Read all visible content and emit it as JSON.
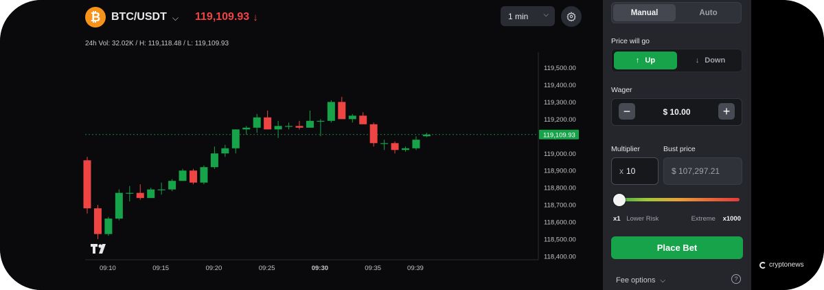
{
  "header": {
    "pair": "BTC/USDT",
    "price": "119,109.93",
    "coin_icon": "bitcoin-icon",
    "stats": "24h Vol: 32.02K / H: 119,118.48 / L: 119,109.93",
    "interval": "1 min"
  },
  "colors": {
    "up": "#16a34a",
    "down": "#ef4444",
    "accent": "#16a34a"
  },
  "chart_data": {
    "type": "candlestick",
    "y_ticks": [
      "119,500.00",
      "119,400.00",
      "119,300.00",
      "119,200.00",
      "119,100.00",
      "119,000.00",
      "118,900.00",
      "118,800.00",
      "118,700.00",
      "118,600.00",
      "118,500.00",
      "118,400.00"
    ],
    "ylim": [
      118380,
      119590
    ],
    "current_price_label": "119,109.93",
    "current_price": 119110,
    "x_ticks": [
      {
        "label": "09:10",
        "bold": false,
        "index": 2
      },
      {
        "label": "09:15",
        "bold": false,
        "index": 7
      },
      {
        "label": "09:20",
        "bold": false,
        "index": 12
      },
      {
        "label": "09:25",
        "bold": false,
        "index": 17
      },
      {
        "label": "09:30",
        "bold": true,
        "index": 22
      },
      {
        "label": "09:35",
        "bold": false,
        "index": 27
      },
      {
        "label": "09:39",
        "bold": false,
        "index": 31
      }
    ],
    "candles": [
      {
        "o": 118960,
        "h": 118980,
        "l": 118650,
        "c": 118680
      },
      {
        "o": 118680,
        "h": 118700,
        "l": 118500,
        "c": 118530
      },
      {
        "o": 118530,
        "h": 118630,
        "l": 118520,
        "c": 118620
      },
      {
        "o": 118620,
        "h": 118790,
        "l": 118610,
        "c": 118770
      },
      {
        "o": 118770,
        "h": 118810,
        "l": 118720,
        "c": 118770
      },
      {
        "o": 118770,
        "h": 118820,
        "l": 118730,
        "c": 118740
      },
      {
        "o": 118740,
        "h": 118800,
        "l": 118740,
        "c": 118790
      },
      {
        "o": 118790,
        "h": 118830,
        "l": 118760,
        "c": 118790
      },
      {
        "o": 118790,
        "h": 118850,
        "l": 118780,
        "c": 118840
      },
      {
        "o": 118840,
        "h": 118910,
        "l": 118840,
        "c": 118900
      },
      {
        "o": 118900,
        "h": 118910,
        "l": 118820,
        "c": 118830
      },
      {
        "o": 118830,
        "h": 118930,
        "l": 118820,
        "c": 118920
      },
      {
        "o": 118920,
        "h": 119040,
        "l": 118910,
        "c": 119000
      },
      {
        "o": 119000,
        "h": 119050,
        "l": 118980,
        "c": 119030
      },
      {
        "o": 119030,
        "h": 119140,
        "l": 119000,
        "c": 119140
      },
      {
        "o": 119140,
        "h": 119160,
        "l": 119110,
        "c": 119150
      },
      {
        "o": 119150,
        "h": 119230,
        "l": 119120,
        "c": 119210
      },
      {
        "o": 119210,
        "h": 119250,
        "l": 119140,
        "c": 119140
      },
      {
        "o": 119140,
        "h": 119190,
        "l": 119090,
        "c": 119160
      },
      {
        "o": 119160,
        "h": 119180,
        "l": 119140,
        "c": 119160
      },
      {
        "o": 119160,
        "h": 119190,
        "l": 119140,
        "c": 119150
      },
      {
        "o": 119150,
        "h": 119250,
        "l": 119150,
        "c": 119190
      },
      {
        "o": 119190,
        "h": 119200,
        "l": 119100,
        "c": 119190
      },
      {
        "o": 119190,
        "h": 119310,
        "l": 119180,
        "c": 119300
      },
      {
        "o": 119300,
        "h": 119330,
        "l": 119200,
        "c": 119200
      },
      {
        "o": 119200,
        "h": 119230,
        "l": 119180,
        "c": 119220
      },
      {
        "o": 119220,
        "h": 119240,
        "l": 119180,
        "c": 119170
      },
      {
        "o": 119170,
        "h": 119180,
        "l": 119040,
        "c": 119060
      },
      {
        "o": 119060,
        "h": 119080,
        "l": 119020,
        "c": 119060
      },
      {
        "o": 119060,
        "h": 119070,
        "l": 119000,
        "c": 119020
      },
      {
        "o": 119020,
        "h": 119040,
        "l": 119010,
        "c": 119030
      },
      {
        "o": 119030,
        "h": 119100,
        "l": 119020,
        "c": 119080
      },
      {
        "o": 119100,
        "h": 119120,
        "l": 119095,
        "c": 119110
      }
    ]
  },
  "panel": {
    "mode_manual": "Manual",
    "mode_auto": "Auto",
    "price_will_go_label": "Price will go",
    "up_label": "Up",
    "down_label": "Down",
    "wager_label": "Wager",
    "wager_value": "$ 10.00",
    "minus": "−",
    "plus": "+",
    "multiplier_label": "Multiplier",
    "bust_price_label": "Bust price",
    "multiplier_prefix": "x",
    "multiplier_value": "10",
    "bust_price_value": "$ 107,297.21",
    "slider_level": 0.0,
    "risk_min_mult": "x1",
    "risk_min_label": "Lower Risk",
    "risk_max_label": "Extreme",
    "risk_max_mult": "x1000",
    "place_bet": "Place Bet",
    "fee_options": "Fee options",
    "help": "?"
  },
  "watermark": "cryptonews"
}
